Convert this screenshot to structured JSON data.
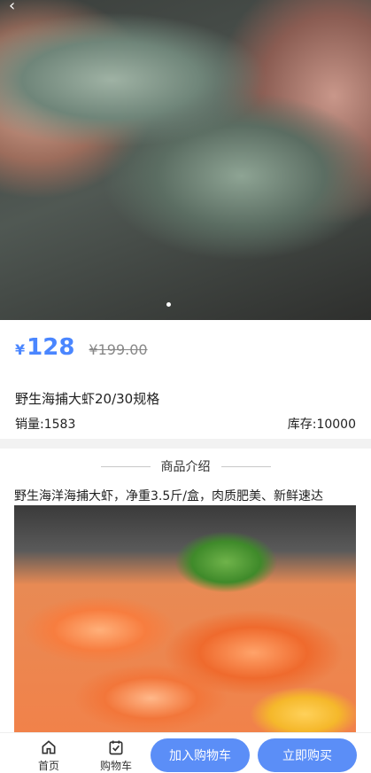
{
  "product": {
    "currency": "¥",
    "price": "128",
    "original_price": "¥199.00",
    "title": "野生海捕大虾20/30规格",
    "sales": "销量:1583",
    "stock": "库存:10000"
  },
  "gallery": {
    "images": [
      "shrimp-hand-photo"
    ],
    "current_index": 0
  },
  "intro": {
    "heading": "商品介绍",
    "description": "野生海洋海捕大虾，净重3.5斤/盒，肉质肥美、新鲜速达"
  },
  "bottom_bar": {
    "home_label": "首页",
    "cart_label": "购物车",
    "add_to_cart_label": "加入购物车",
    "buy_now_label": "立即购买"
  },
  "colors": {
    "accent": "#4a86ff",
    "button": "#5b8ef7"
  }
}
